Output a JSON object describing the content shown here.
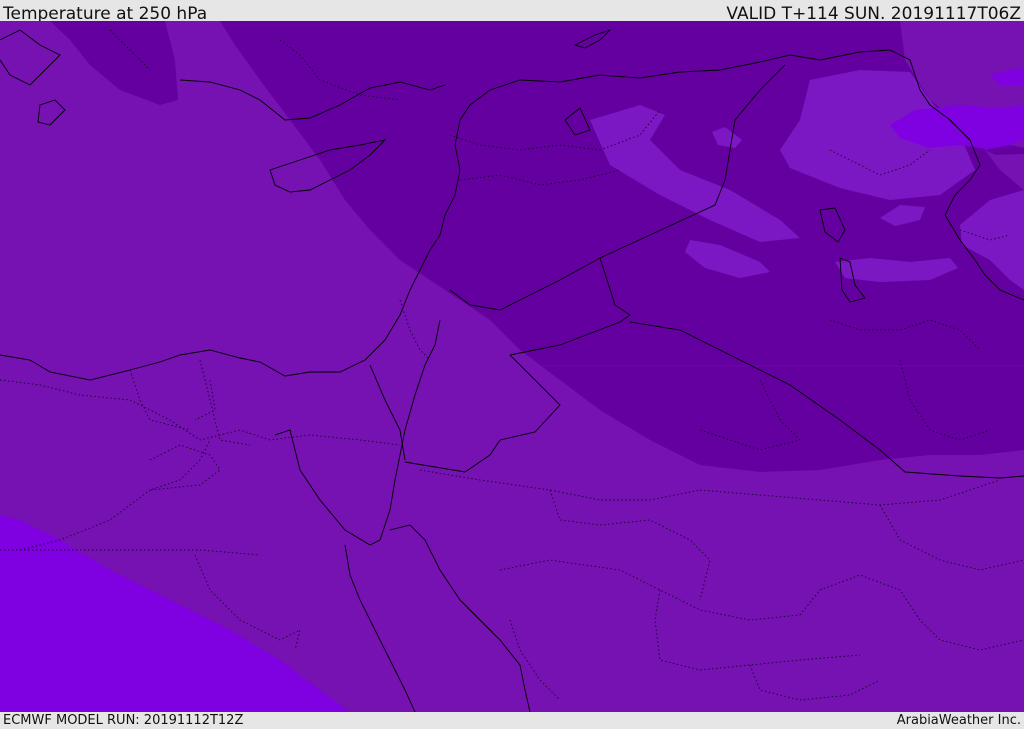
{
  "header": {
    "title": "Temperature at 250 hPa",
    "valid_time": "VALID T+114 SUN. 20191117T06Z"
  },
  "footer": {
    "model_run": "ECMWF MODEL RUN: 20191112T12Z",
    "credit": "ArabiaWeather Inc."
  },
  "colors": {
    "base_field": "#7611b2",
    "cold_band": "#6500a0",
    "warm_field": "#7f00e0",
    "mid_patch": "#7b18c4",
    "coastline": "#000000",
    "border": "#1a0030"
  }
}
